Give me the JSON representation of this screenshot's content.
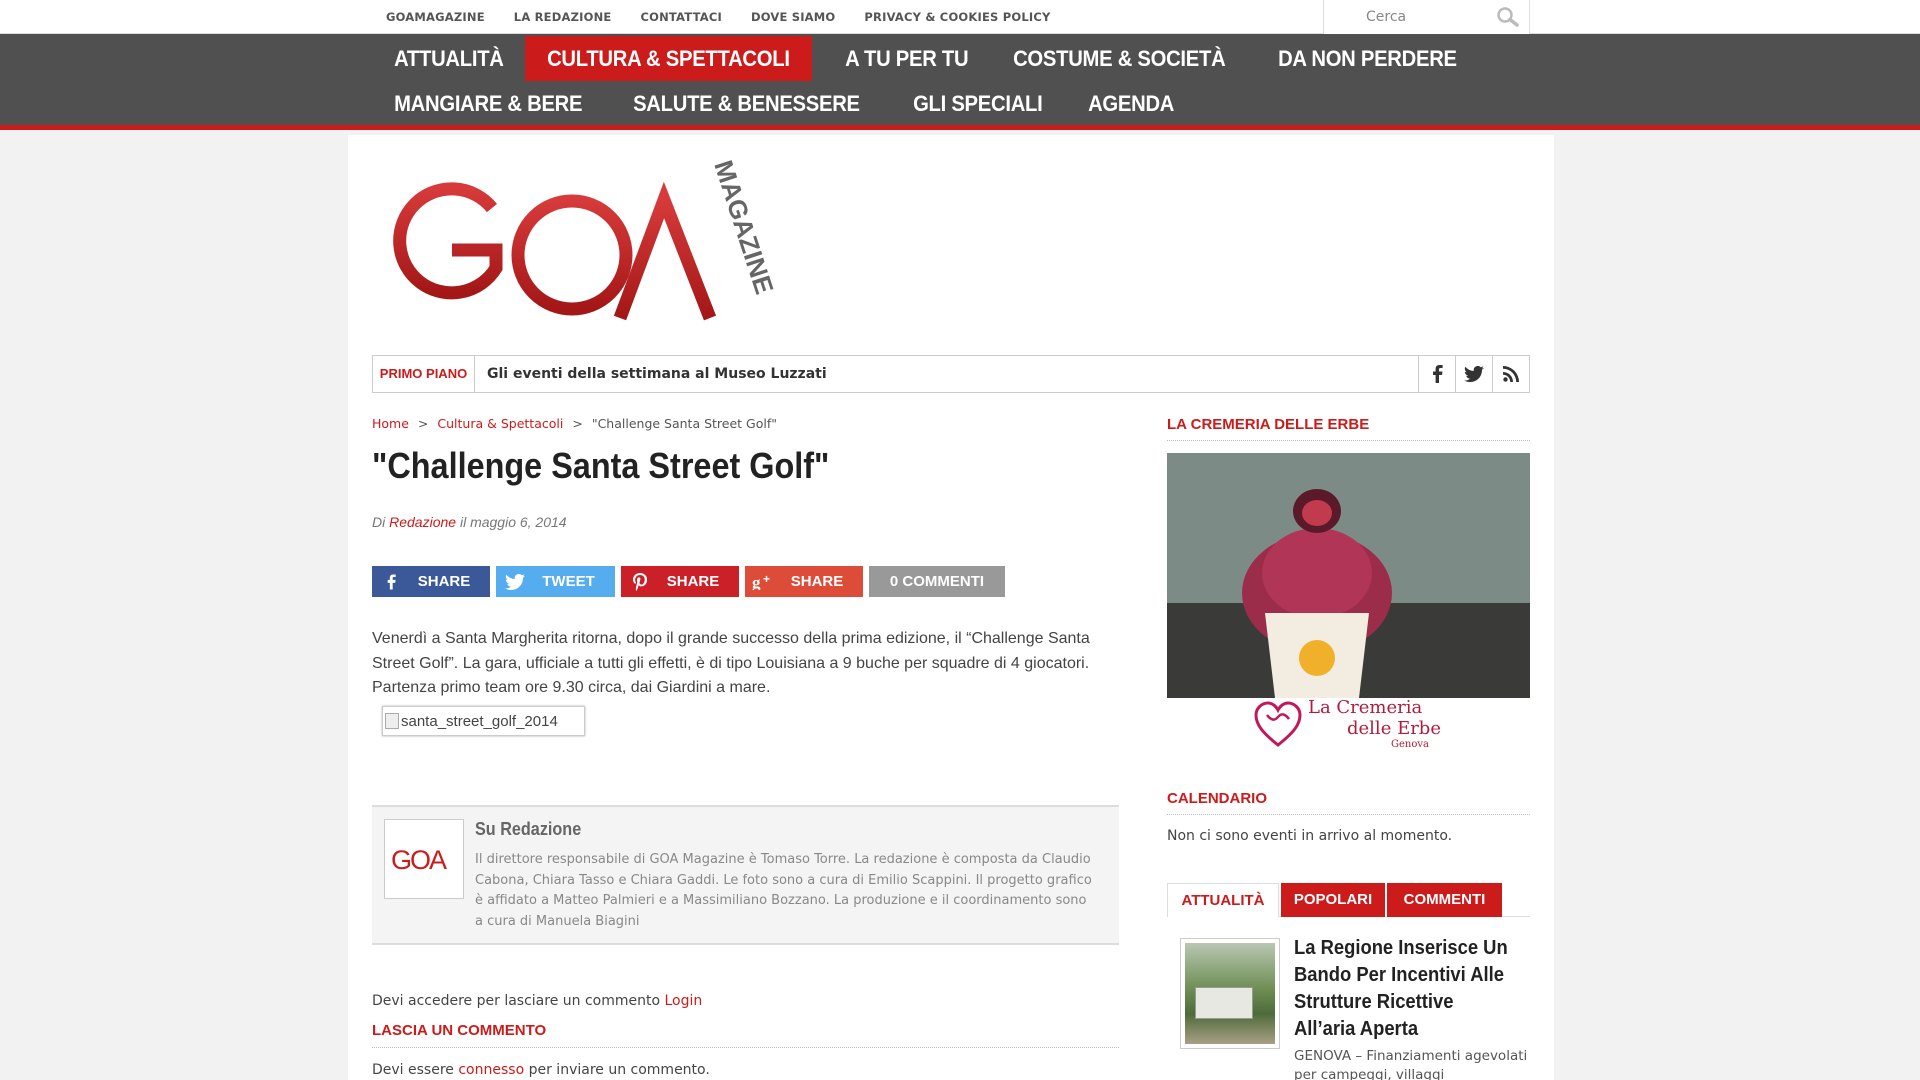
{
  "topbar": {
    "links": [
      "GOAMAGAZINE",
      "LA REDAZIONE",
      "CONTATTACI",
      "DOVE SIAMO",
      "PRIVACY & COOKIES POLICY"
    ],
    "search_placeholder": "Cerca"
  },
  "nav": {
    "row1": [
      "ATTUALITÀ",
      "CULTURA & SPETTACOLI",
      "A TU PER TU",
      "COSTUME & SOCIETÀ",
      "DA NON PERDERE"
    ],
    "row2": [
      "MANGIARE & BERE",
      "SALUTE & BENESSERE",
      "GLI SPECIALI",
      "AGENDA"
    ],
    "active": "CULTURA & SPETTACOLI"
  },
  "logo": {
    "main": "GOA",
    "side": "MAGAZINE"
  },
  "ticker": {
    "label": "PRIMO PIANO",
    "headline": "Gli eventi della settimana al Museo Luzzati"
  },
  "breadcrumb": {
    "home": "Home",
    "section": "Cultura & Spettacoli",
    "current": "\"Challenge Santa Street Golf\"",
    "sep": ">"
  },
  "article": {
    "title": "\"Challenge Santa Street Golf\"",
    "by_prefix": "Di",
    "author": "Redazione",
    "date": "il maggio 6, 2014",
    "body": "Venerdì a Santa Margherita ritorna, dopo il grande successo della prima edizione, il “Challenge Santa Street Golf”. La gara, ufficiale a tutti gli effetti, è di tipo Louisiana a 9 buche per squadre di 4 giocatori. Partenza primo team ore 9.30 circa, dai Giardini a mare.",
    "image_alt": "santa_street_golf_2014"
  },
  "share": {
    "facebook": "SHARE",
    "twitter": "TWEET",
    "pinterest": "SHARE",
    "google": "SHARE",
    "comments": "0 COMMENTI"
  },
  "author_box": {
    "name": "Su Redazione",
    "avatar_text": "GOA",
    "bio": "Il direttore responsabile di GOA Magazine è Tomaso Torre. La redazione è composta da Claudio Cabona, Chiara Tasso e Chiara Gaddi. Le foto sono a cura di Emilio Scappini. Il progetto grafico è affidato a Matteo Palmieri e a Massimiliano Bozzano. La produzione e il coordinamento sono a cura di Manuela Biagini"
  },
  "comments": {
    "login_text": "Devi accedere per lasciare un commento",
    "login_link": "Login",
    "heading": "LASCIA UN COMMENTO",
    "must_prefix": "Devi essere",
    "must_link": "connesso",
    "must_suffix": "per inviare un commento."
  },
  "sidebar": {
    "ad_heading": "LA CREMERIA DELLE ERBE",
    "ad_brand_line1": "La Cremeria",
    "ad_brand_line2": "delle Erbe",
    "ad_brand_line3": "Genova",
    "calendar_heading": "CALENDARIO",
    "calendar_text": "Non ci sono eventi in arrivo al momento.",
    "tabs": [
      "ATTUALITÀ",
      "POPOLARI",
      "COMMENTI"
    ],
    "news_title": "La Regione Inserisce Un Bando Per Incentivi Alle Strutture Ricettive All’aria Aperta",
    "news_excerpt": "GENOVA – Finanziamenti agevolati per campeggi, villaggi"
  },
  "colors": {
    "brand_red": "#cc1b1b",
    "nav_bg": "#505050",
    "facebook": "#3b5998",
    "twitter": "#55acee",
    "pinterest": "#cb2027",
    "google": "#dd4b39"
  }
}
